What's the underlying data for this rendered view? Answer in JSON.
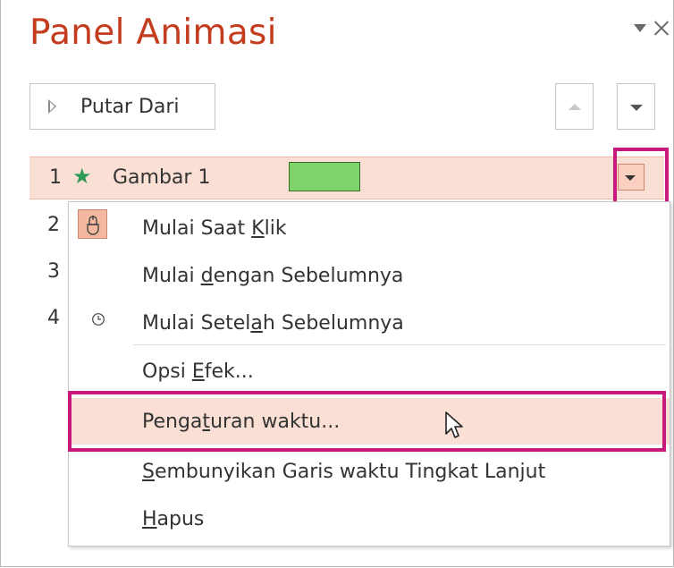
{
  "panel": {
    "title": "Panel Animasi",
    "play_from_label": "Putar Dari"
  },
  "animation_items": [
    {
      "number": "1",
      "name": "Gambar 1"
    },
    {
      "number": "2"
    },
    {
      "number": "3"
    },
    {
      "number": "4"
    }
  ],
  "context_menu": {
    "items": [
      {
        "before": "Mulai Saat ",
        "key": "K",
        "after": "lik",
        "icon": "mouse-click-icon"
      },
      {
        "before": "Mulai ",
        "key": "d",
        "after": "engan Sebelumnya"
      },
      {
        "before": "Mulai Setel",
        "key": "a",
        "after": "h Sebelumnya",
        "icon": "clock-icon"
      },
      {
        "before": "Opsi ",
        "key": "E",
        "after": "fek..."
      },
      {
        "before": "Penga",
        "key": "t",
        "after": "uran waktu..."
      },
      {
        "before": "",
        "key": "S",
        "after": "embunyikan Garis waktu Tingkat Lanjut"
      },
      {
        "before": "",
        "key": "H",
        "after": "apus"
      }
    ]
  },
  "colors": {
    "title": "#c43c1e",
    "selected_row": "#fadfd4",
    "highlight_box": "#c8197d",
    "star": "#2e9a55",
    "swatch": "#7fd36a"
  }
}
